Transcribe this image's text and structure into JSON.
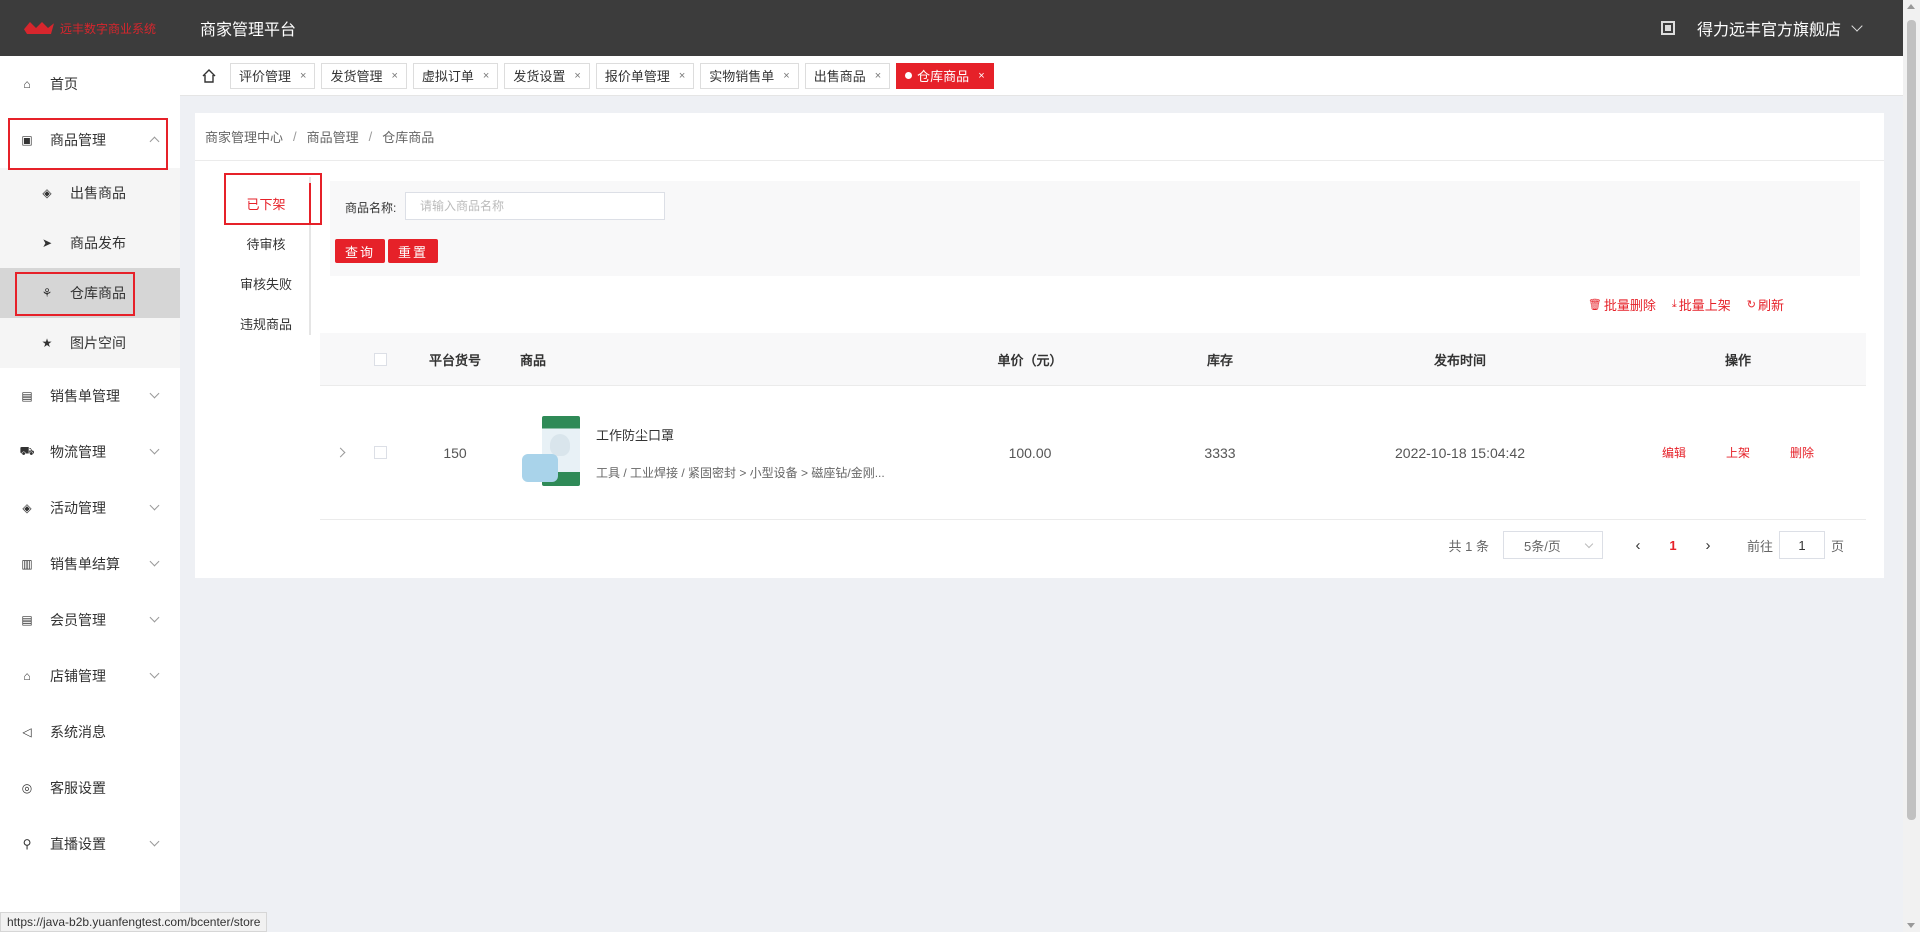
{
  "header": {
    "logo_text": "远丰数字商业系统",
    "platform_title": "商家管理平台",
    "store_name": "得力远丰官方旗舰店"
  },
  "sidebar": {
    "items": [
      {
        "label": "首页"
      },
      {
        "label": "商品管理"
      },
      {
        "label": "出售商品"
      },
      {
        "label": "商品发布"
      },
      {
        "label": "仓库商品"
      },
      {
        "label": "图片空间"
      },
      {
        "label": "销售单管理"
      },
      {
        "label": "物流管理"
      },
      {
        "label": "活动管理"
      },
      {
        "label": "销售单结算"
      },
      {
        "label": "会员管理"
      },
      {
        "label": "店铺管理"
      },
      {
        "label": "系统消息"
      },
      {
        "label": "客服设置"
      },
      {
        "label": "直播设置"
      }
    ]
  },
  "tabs": [
    {
      "label": "评价管理"
    },
    {
      "label": "发货管理"
    },
    {
      "label": "虚拟订单"
    },
    {
      "label": "发货设置"
    },
    {
      "label": "报价单管理"
    },
    {
      "label": "实物销售单"
    },
    {
      "label": "出售商品"
    },
    {
      "label": "仓库商品"
    }
  ],
  "tab_close": "×",
  "breadcrumb": [
    "商家管理中心",
    "商品管理",
    "仓库商品"
  ],
  "breadcrumb_sep": "/",
  "status_nav": [
    "已下架",
    "待审核",
    "审核失败",
    "违规商品"
  ],
  "search": {
    "label": "商品名称:",
    "placeholder": "请输入商品名称",
    "query_button": "查询",
    "reset_button": "重置"
  },
  "actions": {
    "batch_delete": "批量删除",
    "batch_shelve": "批量上架",
    "refresh": "刷新"
  },
  "table": {
    "headers": [
      "平台货号",
      "商品",
      "单价（元）",
      "库存",
      "发布时间",
      "操作"
    ],
    "rows": [
      {
        "sku": "150",
        "name": "工作防尘口罩",
        "category": "工具 / 工业焊接 / 紧固密封 > 小型设备 > 磁座钻/金刚...",
        "price": "100.00",
        "stock": "3333",
        "time": "2022-10-18 15:04:42",
        "ops": [
          "编辑",
          "上架",
          "删除"
        ]
      }
    ]
  },
  "pager": {
    "total": "共 1 条",
    "page_size": "5条/页",
    "current_page": "1",
    "goto_label": "前往",
    "goto_value": "1",
    "page_unit": "页"
  },
  "status_url": "https://java-b2b.yuanfengtest.com/bcenter/store",
  "colors": {
    "accent": "#e62129",
    "header_bg": "#3c3c3c"
  }
}
